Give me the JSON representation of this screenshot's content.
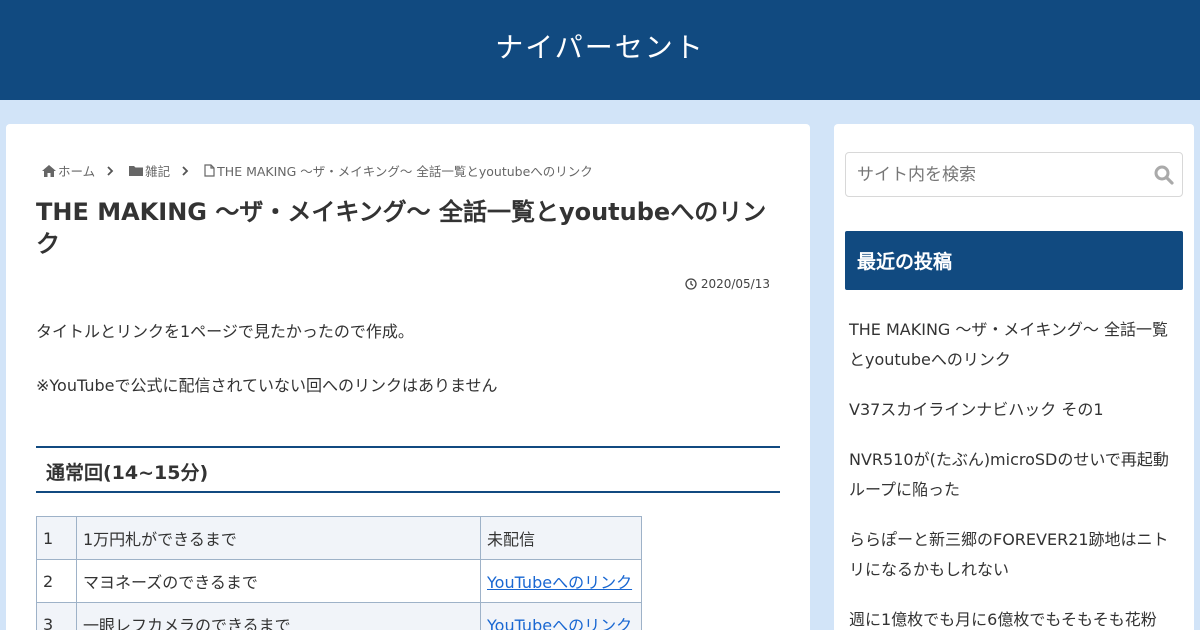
{
  "header": {
    "site_title": "ナイパーセント",
    "color": "#114a80"
  },
  "breadcrumb": {
    "items": [
      {
        "label": "ホーム",
        "icon": "home-icon"
      },
      {
        "label": "雑記",
        "icon": "folder-icon"
      },
      {
        "label": "THE MAKING 〜ザ・メイキング〜 全話一覧とyoutubeへのリンク",
        "icon": "file-icon"
      }
    ],
    "separator_icon": "chevron-right-icon"
  },
  "article": {
    "title": "THE MAKING 〜ザ・メイキング〜 全話一覧とyoutubeへのリンク",
    "date": "2020/05/13",
    "date_icon": "clock-icon",
    "paragraphs": [
      "タイトルとリンクを1ページで見たかったので作成。",
      "※YouTubeで公式に配信されていない回へのリンクはありません"
    ],
    "section_heading": "通常回(14~15分)",
    "table": {
      "rows": [
        {
          "num": "1",
          "title": "1万円札ができるまで",
          "link": "未配信",
          "is_link": false
        },
        {
          "num": "2",
          "title": "マヨネーズのできるまで",
          "link": "YouTubeへのリンク",
          "is_link": true
        },
        {
          "num": "3",
          "title": "一眼レフカメラのできるまで",
          "link": "YouTubeへのリンク",
          "is_link": true
        }
      ]
    }
  },
  "sidebar": {
    "search": {
      "placeholder": "サイト内を検索",
      "icon": "search-icon"
    },
    "recent_title": "最近の投稿",
    "recent_posts": [
      "THE MAKING 〜ザ・メイキング〜 全話一覧とyoutubeへのリンク",
      "V37スカイラインナビハック その1",
      "NVR510が(たぶん)microSDのせいで再起動ループに陥った",
      "ららぽーと新三郷のFOREVER21跡地はニトリになるかもしれない",
      "週に1億枚でも月に6億枚でもそもそも花粉"
    ]
  }
}
